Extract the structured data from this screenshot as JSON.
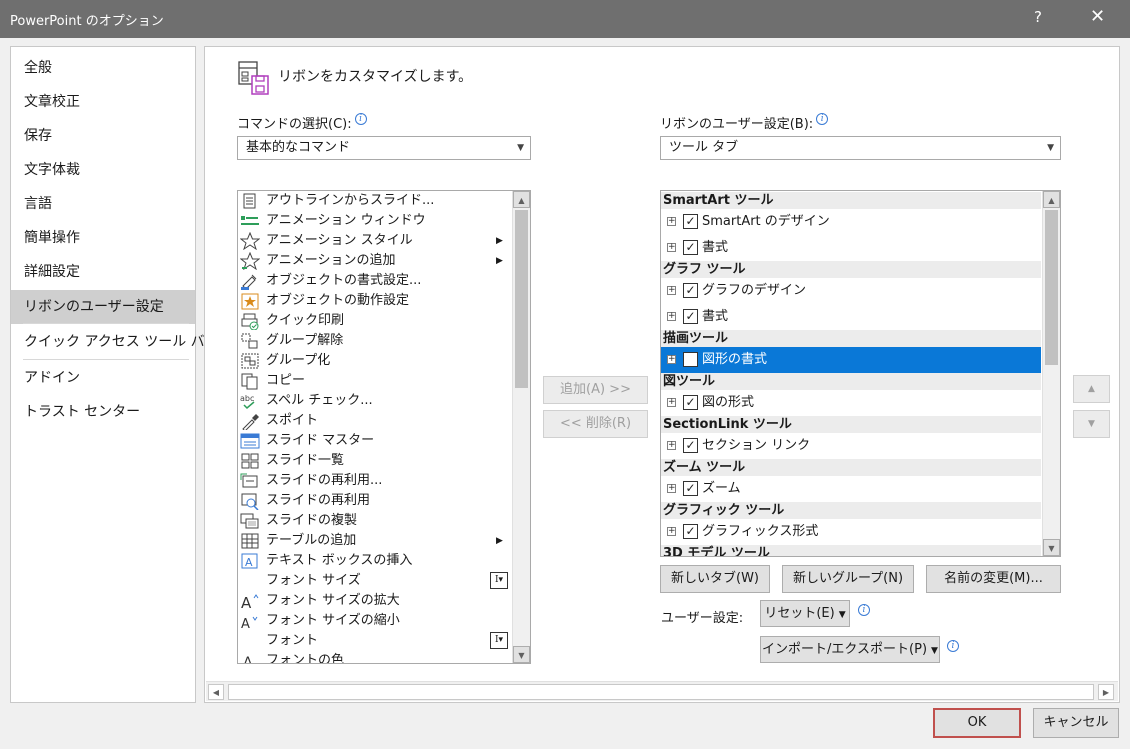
{
  "window": {
    "title": "PowerPoint のオプション",
    "help": "?",
    "close": "✕"
  },
  "nav": {
    "items": [
      {
        "label": "全般"
      },
      {
        "label": "文章校正"
      },
      {
        "label": "保存"
      },
      {
        "label": "文字体裁"
      },
      {
        "label": "言語"
      },
      {
        "label": "簡単操作"
      },
      {
        "label": "詳細設定"
      },
      {
        "label": "リボンのユーザー設定",
        "selected": true
      },
      {
        "label": "クイック アクセス ツール バー"
      },
      {
        "label": "アドイン"
      },
      {
        "label": "トラスト センター"
      }
    ]
  },
  "main": {
    "heading": "リボンをカスタマイズします。",
    "command_label": "コマンドの選択(C):",
    "command_select": "基本的なコマンド",
    "ribbon_label": "リボンのユーザー設定(B):",
    "ribbon_select": "ツール タブ",
    "commands": [
      {
        "icon": "outline-slides-icon",
        "label": "アウトラインからスライド..."
      },
      {
        "icon": "animation-pane-icon",
        "label": "アニメーション ウィンドウ"
      },
      {
        "icon": "animation-style-icon",
        "label": "アニメーション スタイル",
        "submenu": "▶"
      },
      {
        "icon": "add-animation-icon",
        "label": "アニメーションの追加",
        "submenu": "▶"
      },
      {
        "icon": "format-object-icon",
        "label": "オブジェクトの書式設定..."
      },
      {
        "icon": "object-action-icon",
        "label": "オブジェクトの動作設定"
      },
      {
        "icon": "quick-print-icon",
        "label": "クイック印刷"
      },
      {
        "icon": "ungroup-icon",
        "label": "グループ解除"
      },
      {
        "icon": "group-icon",
        "label": "グループ化"
      },
      {
        "icon": "copy-icon",
        "label": "コピー"
      },
      {
        "icon": "spell-check-icon",
        "label": "スペル チェック..."
      },
      {
        "icon": "eyedropper-icon",
        "label": "スポイト"
      },
      {
        "icon": "slide-master-icon",
        "label": "スライド マスター"
      },
      {
        "icon": "slide-sorter-icon",
        "label": "スライド一覧"
      },
      {
        "icon": "reuse-slides-icon",
        "label": "スライドの再利用..."
      },
      {
        "icon": "reuse-slides-search-icon",
        "label": "スライドの再利用"
      },
      {
        "icon": "duplicate-slide-icon",
        "label": "スライドの複製"
      },
      {
        "icon": "add-table-icon",
        "label": "テーブルの追加",
        "submenu": "▶"
      },
      {
        "icon": "insert-textbox-icon",
        "label": "テキスト ボックスの挿入"
      },
      {
        "icon": "",
        "label": "フォント サイズ",
        "combo": "I▾"
      },
      {
        "icon": "font-size-increase-icon",
        "label": "フォント サイズの拡大"
      },
      {
        "icon": "font-size-decrease-icon",
        "label": "フォント サイズの縮小"
      },
      {
        "icon": "",
        "label": "フォント",
        "combo": "I▾"
      },
      {
        "icon": "font-color-icon",
        "label": "フォントの色"
      }
    ],
    "ribbon_tree": [
      {
        "kind": "group",
        "label": "SmartArt ツール"
      },
      {
        "kind": "tab",
        "label": "SmartArt のデザイン",
        "checked": true
      },
      {
        "kind": "tab",
        "label": "書式",
        "checked": true
      },
      {
        "kind": "group",
        "label": "グラフ ツール"
      },
      {
        "kind": "tab",
        "label": "グラフのデザイン",
        "checked": true
      },
      {
        "kind": "tab",
        "label": "書式",
        "checked": true
      },
      {
        "kind": "group",
        "label": "描画ツール"
      },
      {
        "kind": "tab",
        "label": "図形の書式",
        "checked": false,
        "selected": true
      },
      {
        "kind": "group",
        "label": "図ツール"
      },
      {
        "kind": "tab",
        "label": "図の形式",
        "checked": true
      },
      {
        "kind": "group",
        "label": "SectionLink ツール"
      },
      {
        "kind": "tab",
        "label": "セクション リンク",
        "checked": true
      },
      {
        "kind": "group",
        "label": "ズーム ツール"
      },
      {
        "kind": "tab",
        "label": "ズーム",
        "checked": true
      },
      {
        "kind": "group",
        "label": "グラフィック ツール"
      },
      {
        "kind": "tab",
        "label": "グラフィックス形式",
        "checked": true
      },
      {
        "kind": "group",
        "label": "3D モデル ツール"
      }
    ],
    "add_button": "追加(A) >>",
    "remove_button": "<< 削除(R)",
    "move_up": "▲",
    "move_down": "▼",
    "new_tab_button": "新しいタブ(W)",
    "new_group_button": "新しいグループ(N)",
    "rename_button": "名前の変更(M)...",
    "user_settings_label": "ユーザー設定:",
    "reset_button": "リセット(E)",
    "import_export_button": "インポート/エクスポート(P)",
    "dropdown_arrow": "▼",
    "scroll_up": "▲",
    "scroll_down": "▼",
    "scroll_left": "◀",
    "scroll_right": "▶",
    "check_mark": "✓",
    "expand_mark": "+",
    "info_mark": "i"
  },
  "footer": {
    "ok_button": "OK",
    "cancel_button": "キャンセル"
  },
  "colors": {
    "titlebar": "#6f6f6f",
    "selection": "#0a78d7",
    "ok_border": "#c0504d"
  }
}
